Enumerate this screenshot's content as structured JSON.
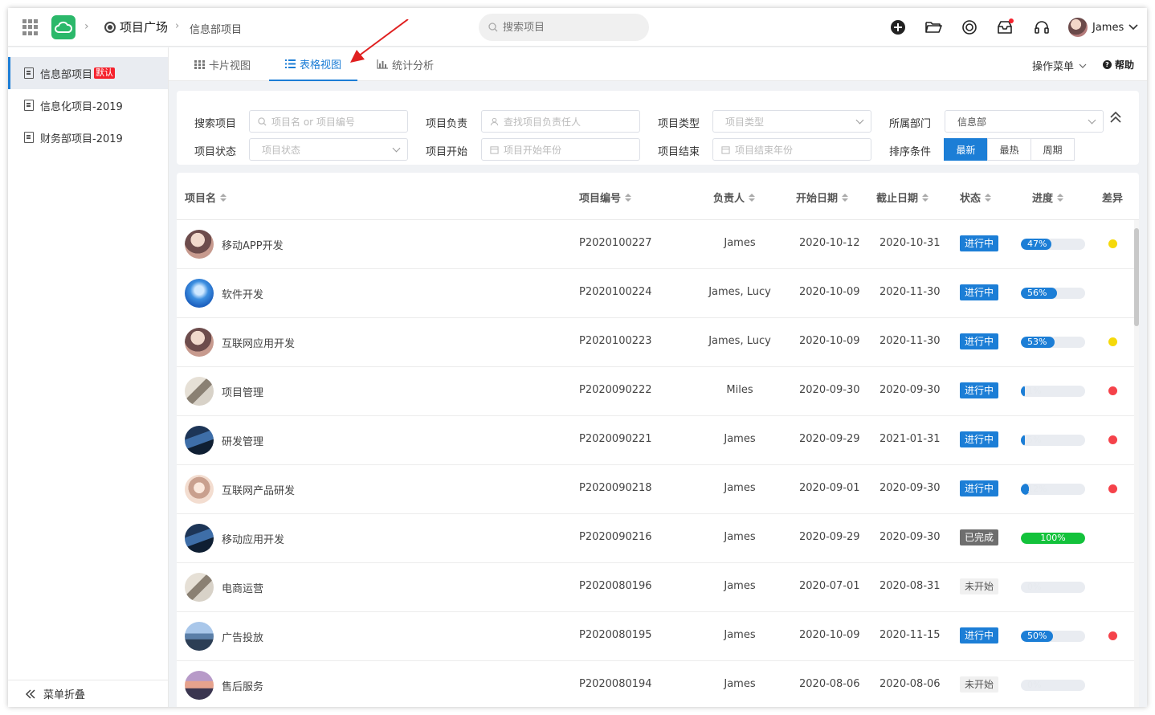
{
  "header": {
    "breadcrumb_root": "项目广场",
    "breadcrumb_current": "信息部项目",
    "search_placeholder": "搜索项目",
    "user_name": "James"
  },
  "sidebar": {
    "items": [
      {
        "label": "信息部项目",
        "badge": "默认",
        "active": true
      },
      {
        "label": "信息化项目-2019",
        "active": false
      },
      {
        "label": "财务部项目-2019",
        "active": false
      }
    ],
    "collapse_label": "菜单折叠"
  },
  "tabs": [
    {
      "label": "卡片视图",
      "active": false,
      "icon": "grid-icon"
    },
    {
      "label": "表格视图",
      "active": true,
      "icon": "list-icon"
    },
    {
      "label": "统计分析",
      "active": false,
      "icon": "bar-chart-icon"
    }
  ],
  "toolbar": {
    "ops_label": "操作菜单",
    "help_label": "帮助"
  },
  "filters": {
    "search_label": "搜索项目",
    "search_placeholder": "项目名 or 项目编号",
    "owner_label": "项目负责",
    "owner_placeholder": "查找项目负责任人",
    "type_label": "项目类型",
    "type_placeholder": "项目类型",
    "dept_label": "所属部门",
    "dept_value": "信息部",
    "status_label": "项目状态",
    "status_placeholder": "项目状态",
    "start_label": "项目开始",
    "start_placeholder": "项目开始年份",
    "end_label": "项目结束",
    "end_placeholder": "项目结束年份",
    "sort_label": "排序条件",
    "sort_options": [
      "最新",
      "最热",
      "周期"
    ],
    "sort_selected": "最新"
  },
  "table": {
    "columns": [
      "项目名",
      "项目编号",
      "负责人",
      "开始日期",
      "截止日期",
      "状态",
      "进度",
      "差异"
    ],
    "rows": [
      {
        "name": "移动APP开发",
        "code": "P2020100227",
        "owner": "James",
        "start": "2020-10-12",
        "end": "2020-10-31",
        "status": "进行中",
        "progress": 47,
        "progress_label": "47%",
        "diff": "yellow"
      },
      {
        "name": "软件开发",
        "code": "P2020100224",
        "owner": "James, Lucy",
        "start": "2020-10-09",
        "end": "2020-11-30",
        "status": "进行中",
        "progress": 56,
        "progress_label": "56%",
        "diff": ""
      },
      {
        "name": "互联网应用开发",
        "code": "P2020100223",
        "owner": "James, Lucy",
        "start": "2020-10-09",
        "end": "2020-11-30",
        "status": "进行中",
        "progress": 53,
        "progress_label": "53%",
        "diff": "yellow"
      },
      {
        "name": "项目管理",
        "code": "P2020090222",
        "owner": "Miles",
        "start": "2020-09-30",
        "end": "2020-09-30",
        "status": "进行中",
        "progress": 1,
        "progress_label": "1%",
        "diff": "red"
      },
      {
        "name": "研发管理",
        "code": "P2020090221",
        "owner": "James",
        "start": "2020-09-29",
        "end": "2021-01-31",
        "status": "进行中",
        "progress": 5,
        "progress_label": "5%",
        "diff": "red"
      },
      {
        "name": "互联网产品研发",
        "code": "P2020090218",
        "owner": "James",
        "start": "2020-09-01",
        "end": "2020-09-30",
        "status": "进行中",
        "progress": 12,
        "progress_label": "12%",
        "diff": "red"
      },
      {
        "name": "移动应用开发",
        "code": "P2020090216",
        "owner": "James",
        "start": "2020-09-29",
        "end": "2020-09-30",
        "status": "已完成",
        "progress": 100,
        "progress_label": "100%",
        "diff": ""
      },
      {
        "name": "电商运营",
        "code": "P2020080196",
        "owner": "James",
        "start": "2020-07-01",
        "end": "2020-08-31",
        "status": "未开始",
        "progress": 0,
        "progress_label": "0%",
        "diff": ""
      },
      {
        "name": "广告投放",
        "code": "P2020080195",
        "owner": "James",
        "start": "2020-10-09",
        "end": "2020-11-15",
        "status": "进行中",
        "progress": 50,
        "progress_label": "50%",
        "diff": "red"
      },
      {
        "name": "售后服务",
        "code": "P2020080194",
        "owner": "James",
        "start": "2020-08-06",
        "end": "2020-08-06",
        "status": "未开始",
        "progress": 0,
        "progress_label": "0%",
        "diff": ""
      }
    ]
  },
  "colors": {
    "accent": "#1c7ed6",
    "success": "#13c23b",
    "diff_yellow": "#f5d90a",
    "diff_red": "#f5424a",
    "logo": "#2bb86a"
  }
}
